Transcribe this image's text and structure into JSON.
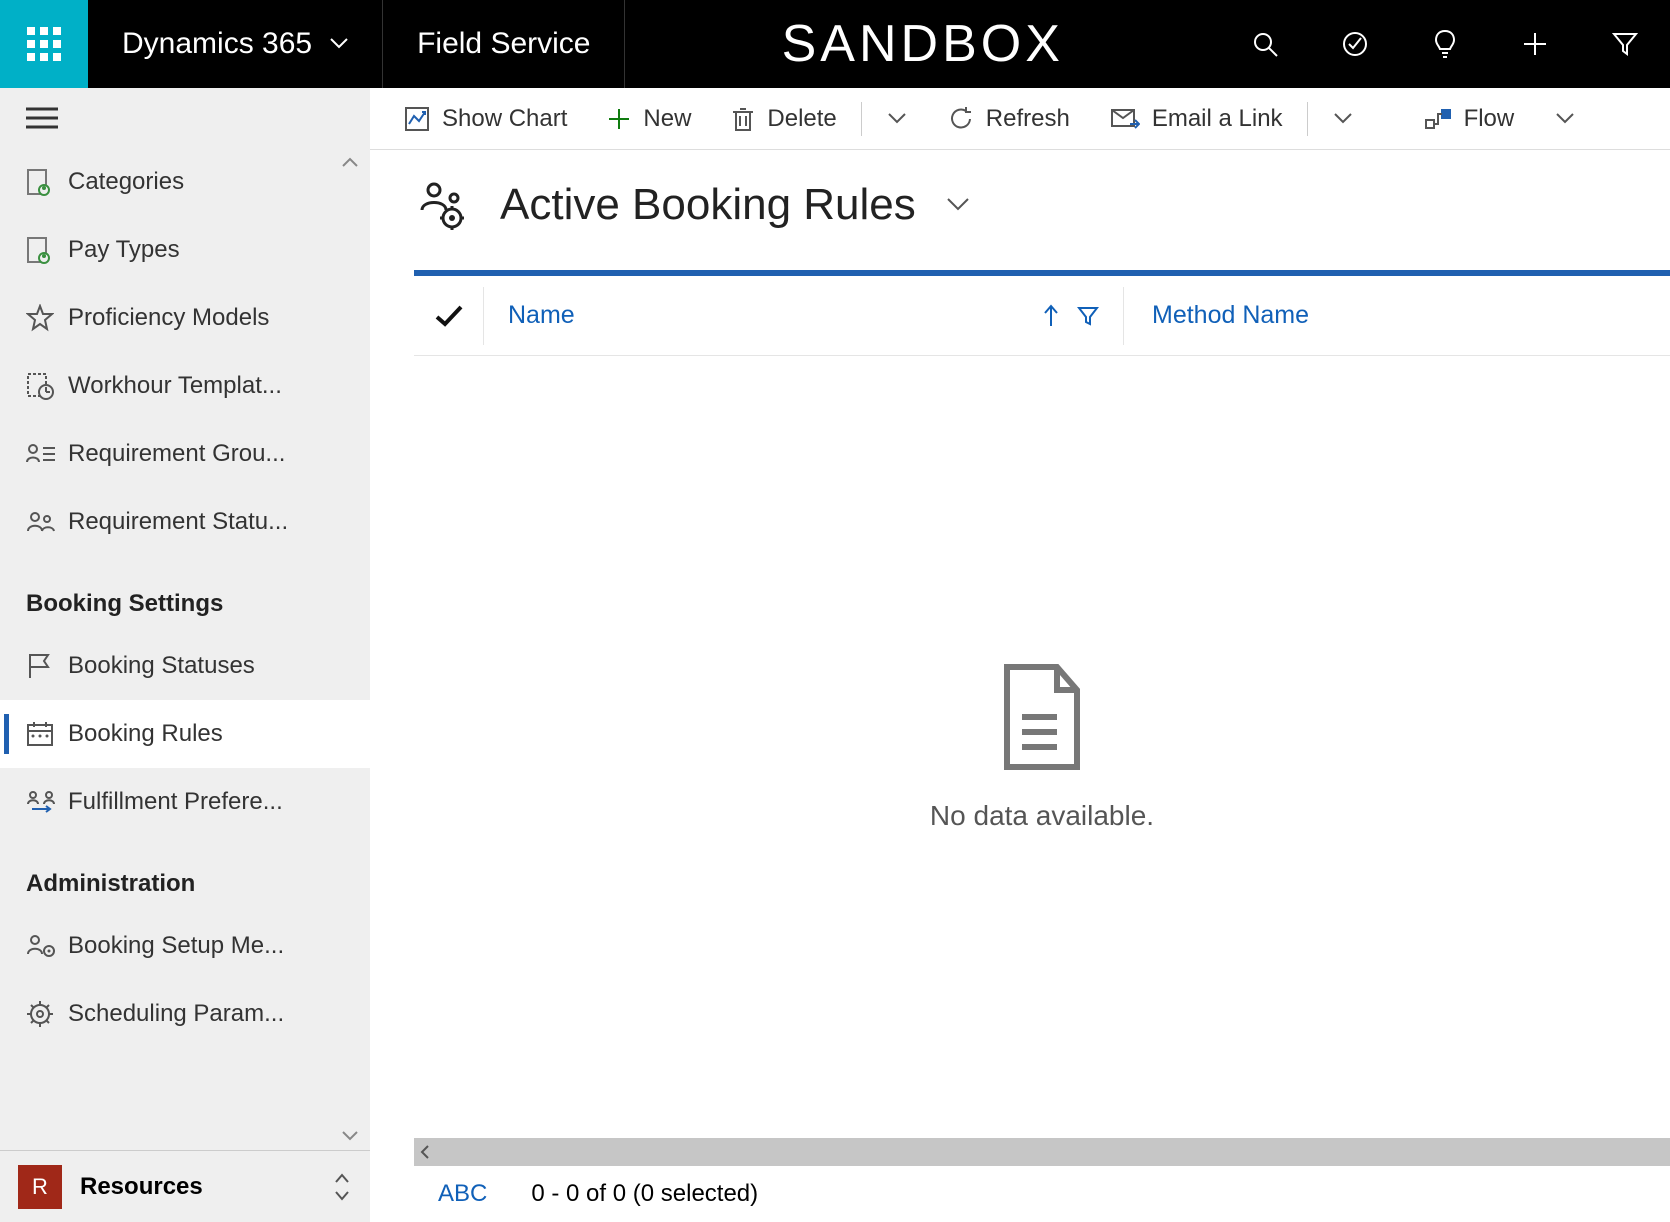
{
  "header": {
    "app_name": "Dynamics 365",
    "module": "Field Service",
    "environment": "SANDBOX"
  },
  "sidebar": {
    "items_top": [
      {
        "label": "Categories"
      },
      {
        "label": "Pay Types"
      },
      {
        "label": "Proficiency Models"
      },
      {
        "label": "Workhour Templat..."
      },
      {
        "label": "Requirement Grou..."
      },
      {
        "label": "Requirement Statu..."
      }
    ],
    "group1": "Booking Settings",
    "items_group1": [
      {
        "label": "Booking Statuses"
      },
      {
        "label": "Booking Rules",
        "active": true
      },
      {
        "label": "Fulfillment Prefere..."
      }
    ],
    "group2": "Administration",
    "items_group2": [
      {
        "label": "Booking Setup Me..."
      },
      {
        "label": "Scheduling Param..."
      }
    ],
    "area": {
      "initial": "R",
      "label": "Resources"
    }
  },
  "commands": {
    "show_chart": "Show Chart",
    "new": "New",
    "delete": "Delete",
    "refresh": "Refresh",
    "email_link": "Email a Link",
    "flow": "Flow"
  },
  "page": {
    "title": "Active Booking Rules"
  },
  "grid": {
    "columns": {
      "name": "Name",
      "method": "Method Name"
    },
    "empty_message": "No data available.",
    "footer": {
      "jump": "ABC",
      "paging": "0 - 0 of 0 (0 selected)"
    }
  }
}
